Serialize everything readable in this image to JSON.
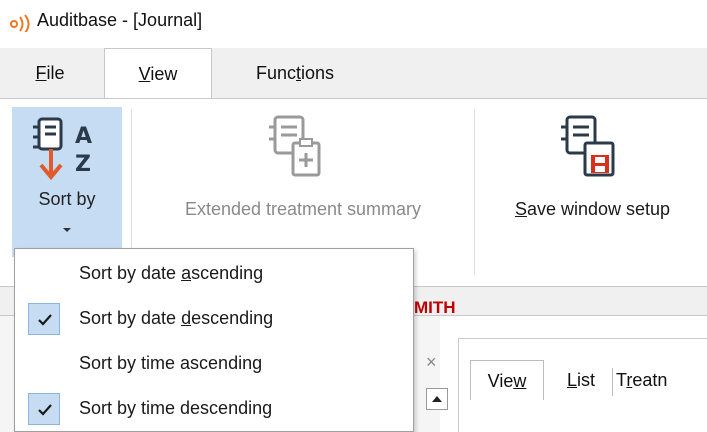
{
  "window": {
    "title": "Auditbase - [Journal]",
    "logo_icon": "signal-waves-logo"
  },
  "menu": {
    "tabs": [
      {
        "label_pre": "",
        "label_key": "F",
        "label_post": "ile"
      },
      {
        "label_pre": "",
        "label_key": "V",
        "label_post": "iew"
      },
      {
        "label_pre": "Func",
        "label_key": "t",
        "label_post": "ions"
      }
    ],
    "active_tab": "View"
  },
  "ribbon": {
    "sort_by": {
      "label": "Sort by",
      "icon": "sort-az-icon"
    },
    "extended_treatment_summary": {
      "label": "Extended treatment summary",
      "icon": "clipboard-add-icon",
      "enabled": false
    },
    "save_window_setup": {
      "label_key": "S",
      "label_post": "ave window setup",
      "icon": "save-layout-icon"
    }
  },
  "dropdown": {
    "items": [
      {
        "pre": "Sort by date ",
        "key": "a",
        "post": "scending",
        "checked": false
      },
      {
        "pre": "Sort by date ",
        "key": "d",
        "post": "escending",
        "checked": true
      },
      {
        "pre": "Sort by time ascending",
        "key": "",
        "post": "",
        "checked": false
      },
      {
        "pre": "Sort by time descending",
        "key": "",
        "post": "",
        "checked": true
      }
    ]
  },
  "background": {
    "patient_name_fragment": "MITH",
    "close_glyph": "×",
    "subtabs": [
      {
        "pre": "Vie",
        "key": "w",
        "post": ""
      },
      {
        "pre": "",
        "key": "L",
        "post": "ist"
      },
      {
        "pre": "T",
        "key": "r",
        "post": "eatn"
      }
    ]
  },
  "colors": {
    "accent_selected": "#c6dcf3",
    "disabled_text": "#8a8a8a",
    "patient_name": "#c00000",
    "logo_orange": "#f07820",
    "save_red": "#d9301c"
  }
}
